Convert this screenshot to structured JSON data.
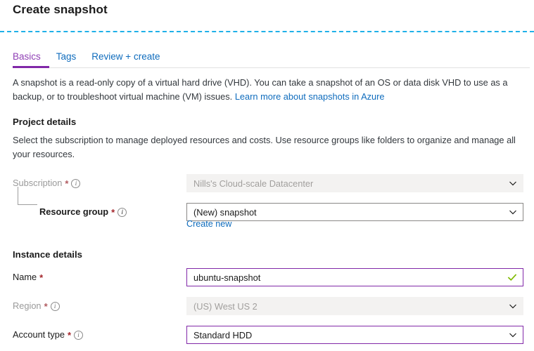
{
  "page": {
    "title": "Create snapshot"
  },
  "tabs": [
    {
      "label": "Basics",
      "active": true
    },
    {
      "label": "Tags",
      "active": false
    },
    {
      "label": "Review + create",
      "active": false
    }
  ],
  "description": {
    "text": "A snapshot is a read-only copy of a virtual hard drive (VHD). You can take a snapshot of an OS or data disk VHD to use as a backup, or to troubleshoot virtual machine (VM) issues.",
    "link_label": "Learn more about snapshots in Azure"
  },
  "project_details": {
    "heading": "Project details",
    "helper": "Select the subscription to manage deployed resources and costs. Use resource groups like folders to organize and manage all your resources.",
    "subscription": {
      "label": "Subscription",
      "required_marker": "*",
      "info_glyph": "i",
      "value": "Nills's Cloud-scale Datacenter",
      "state": "disabled"
    },
    "resource_group": {
      "label": "Resource group",
      "required_marker": "*",
      "info_glyph": "i",
      "value": "(New) snapshot",
      "state": "enabled",
      "create_new_label": "Create new"
    }
  },
  "instance_details": {
    "heading": "Instance details",
    "name": {
      "label": "Name",
      "required_marker": "*",
      "value": "ubuntu-snapshot",
      "state": "validated"
    },
    "region": {
      "label": "Region",
      "required_marker": "*",
      "info_glyph": "i",
      "value": "(US) West US 2",
      "state": "disabled"
    },
    "account_type": {
      "label": "Account type",
      "required_marker": "*",
      "info_glyph": "i",
      "value": "Standard HDD",
      "state": "focused"
    }
  },
  "colors": {
    "accent_purple": "#8128a8",
    "link_blue": "#0f6cbd",
    "required_red": "#a4262c",
    "divider_cyan": "#1fb0e8",
    "valid_green": "#7fba00",
    "disabled_bg": "#f3f2f1"
  }
}
